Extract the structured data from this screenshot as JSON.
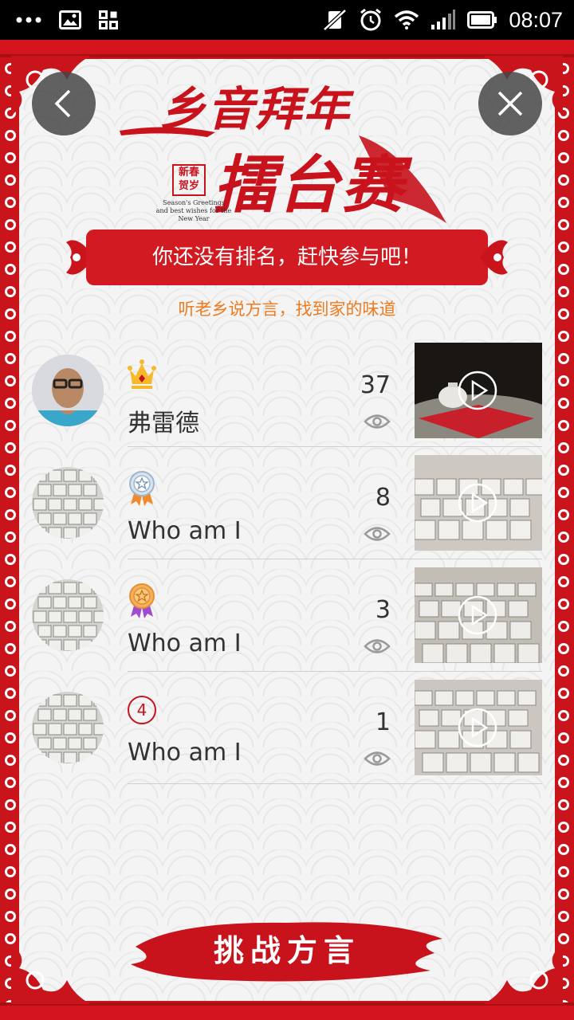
{
  "status_bar": {
    "time": "08:07"
  },
  "header": {
    "title_line1": "乡音拜年",
    "title_line2": "擂台赛",
    "seal_text": "新春 贺岁",
    "greeting_line1": "Season's Greetings",
    "greeting_line2": "and best wishes for the New Year"
  },
  "banner": {
    "text": "你还没有排名，赶快参与吧！"
  },
  "subtitle": "听老乡说方言，找到家的味道",
  "rankings": [
    {
      "rank_badge": "crown-icon",
      "name": "弗雷德",
      "views": "37"
    },
    {
      "rank_badge": "silver-medal-icon",
      "name": "Who am I",
      "views": "8"
    },
    {
      "rank_badge": "bronze-medal-icon",
      "name": "Who am I",
      "views": "3"
    },
    {
      "rank_badge": "rank-number-badge",
      "rank_number": "4",
      "name": "Who am I",
      "views": "1"
    }
  ],
  "footer": {
    "challenge_label": "挑战方言"
  },
  "colors": {
    "frame_red": "#c9141c",
    "banner_red": "#d11a22",
    "subtitle_orange": "#f07a1e"
  }
}
